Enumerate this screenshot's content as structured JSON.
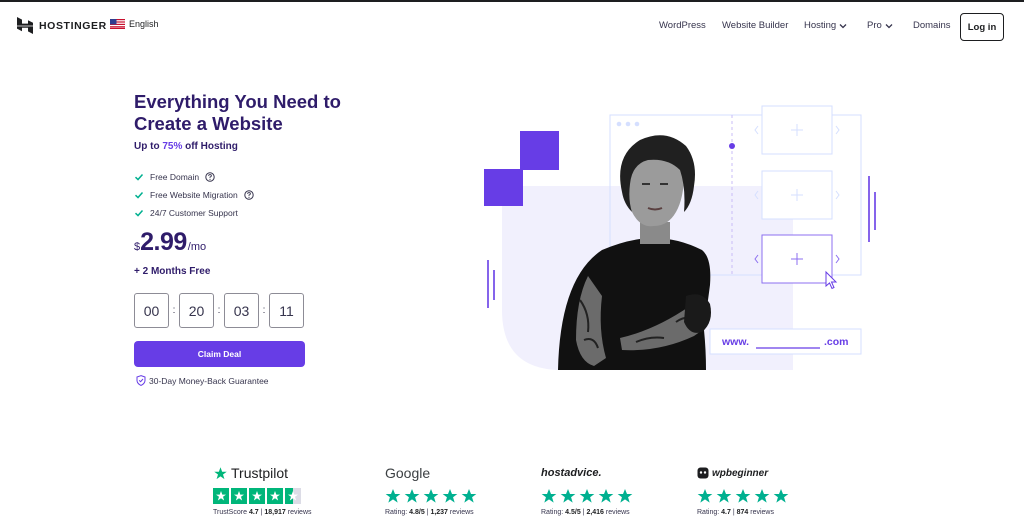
{
  "header": {
    "brand": "HOSTINGER",
    "language": "English",
    "nav": {
      "wordpress": "WordPress",
      "website_builder": "Website Builder",
      "hosting": "Hosting",
      "pro": "Pro",
      "domains": "Domains"
    },
    "login_label": "Log in"
  },
  "hero": {
    "title_line1": "Everything You Need to",
    "title_line2": "Create a Website",
    "subtitle_prefix": "Up to ",
    "subtitle_highlight": "75%",
    "subtitle_suffix": " off Hosting",
    "features": [
      "Free Domain",
      "Free Website Migration",
      "24/7 Customer Support"
    ],
    "price": {
      "currency": "$",
      "amount": "2.99",
      "period": "/mo"
    },
    "bonus": "+ 2 Months Free",
    "timer": {
      "days": "00",
      "hours": "20",
      "minutes": "03",
      "seconds": "11"
    },
    "cta_label": "Claim Deal",
    "guarantee": "30-Day Money-Back Guarantee"
  },
  "illustration": {
    "domain_prefix": "www.",
    "domain_suffix": ".com"
  },
  "reviews": [
    {
      "brand": "Trustpilot",
      "score_label": "TrustScore",
      "score": "4.7",
      "count": "18,917",
      "count_label": "reviews"
    },
    {
      "brand": "Google",
      "score_label": "Rating:",
      "score": "4.8/5",
      "count": "1,237",
      "count_label": "reviews"
    },
    {
      "brand": "hostadvice.",
      "score_label": "Rating:",
      "score": "4.5/5",
      "count": "2,416",
      "count_label": "reviews"
    },
    {
      "brand": "wpbeginner",
      "score_label": "Rating:",
      "score": "4.7",
      "count": "874",
      "count_label": "reviews"
    }
  ],
  "colors": {
    "primary": "#673de6",
    "heading": "#2f1c6a",
    "trustpilot_green": "#00b67a",
    "check_green": "#00b090"
  }
}
